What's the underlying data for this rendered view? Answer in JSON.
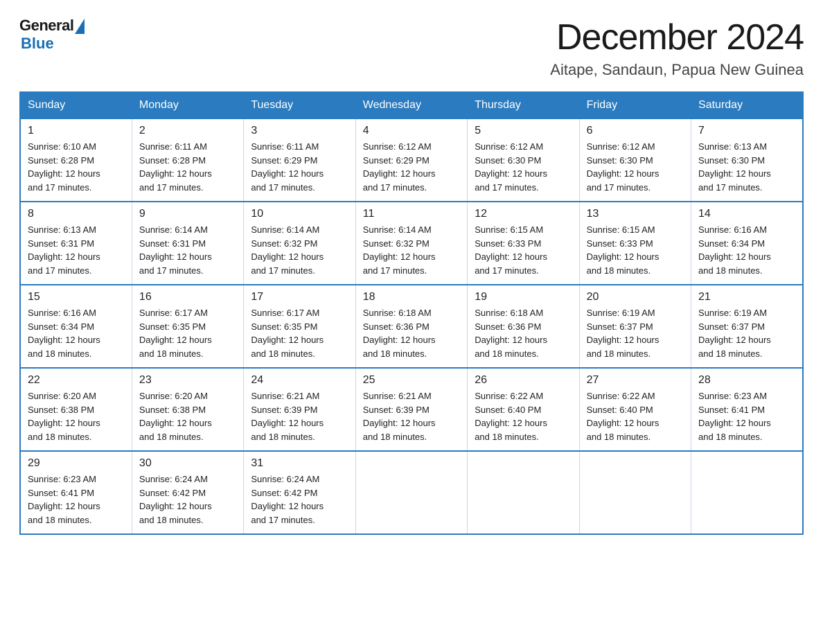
{
  "header": {
    "logo_general": "General",
    "logo_blue": "Blue",
    "month_title": "December 2024",
    "location": "Aitape, Sandaun, Papua New Guinea"
  },
  "weekdays": [
    "Sunday",
    "Monday",
    "Tuesday",
    "Wednesday",
    "Thursday",
    "Friday",
    "Saturday"
  ],
  "weeks": [
    [
      {
        "day": "1",
        "sunrise": "6:10 AM",
        "sunset": "6:28 PM",
        "daylight": "12 hours and 17 minutes."
      },
      {
        "day": "2",
        "sunrise": "6:11 AM",
        "sunset": "6:28 PM",
        "daylight": "12 hours and 17 minutes."
      },
      {
        "day": "3",
        "sunrise": "6:11 AM",
        "sunset": "6:29 PM",
        "daylight": "12 hours and 17 minutes."
      },
      {
        "day": "4",
        "sunrise": "6:12 AM",
        "sunset": "6:29 PM",
        "daylight": "12 hours and 17 minutes."
      },
      {
        "day": "5",
        "sunrise": "6:12 AM",
        "sunset": "6:30 PM",
        "daylight": "12 hours and 17 minutes."
      },
      {
        "day": "6",
        "sunrise": "6:12 AM",
        "sunset": "6:30 PM",
        "daylight": "12 hours and 17 minutes."
      },
      {
        "day": "7",
        "sunrise": "6:13 AM",
        "sunset": "6:30 PM",
        "daylight": "12 hours and 17 minutes."
      }
    ],
    [
      {
        "day": "8",
        "sunrise": "6:13 AM",
        "sunset": "6:31 PM",
        "daylight": "12 hours and 17 minutes."
      },
      {
        "day": "9",
        "sunrise": "6:14 AM",
        "sunset": "6:31 PM",
        "daylight": "12 hours and 17 minutes."
      },
      {
        "day": "10",
        "sunrise": "6:14 AM",
        "sunset": "6:32 PM",
        "daylight": "12 hours and 17 minutes."
      },
      {
        "day": "11",
        "sunrise": "6:14 AM",
        "sunset": "6:32 PM",
        "daylight": "12 hours and 17 minutes."
      },
      {
        "day": "12",
        "sunrise": "6:15 AM",
        "sunset": "6:33 PM",
        "daylight": "12 hours and 17 minutes."
      },
      {
        "day": "13",
        "sunrise": "6:15 AM",
        "sunset": "6:33 PM",
        "daylight": "12 hours and 18 minutes."
      },
      {
        "day": "14",
        "sunrise": "6:16 AM",
        "sunset": "6:34 PM",
        "daylight": "12 hours and 18 minutes."
      }
    ],
    [
      {
        "day": "15",
        "sunrise": "6:16 AM",
        "sunset": "6:34 PM",
        "daylight": "12 hours and 18 minutes."
      },
      {
        "day": "16",
        "sunrise": "6:17 AM",
        "sunset": "6:35 PM",
        "daylight": "12 hours and 18 minutes."
      },
      {
        "day": "17",
        "sunrise": "6:17 AM",
        "sunset": "6:35 PM",
        "daylight": "12 hours and 18 minutes."
      },
      {
        "day": "18",
        "sunrise": "6:18 AM",
        "sunset": "6:36 PM",
        "daylight": "12 hours and 18 minutes."
      },
      {
        "day": "19",
        "sunrise": "6:18 AM",
        "sunset": "6:36 PM",
        "daylight": "12 hours and 18 minutes."
      },
      {
        "day": "20",
        "sunrise": "6:19 AM",
        "sunset": "6:37 PM",
        "daylight": "12 hours and 18 minutes."
      },
      {
        "day": "21",
        "sunrise": "6:19 AM",
        "sunset": "6:37 PM",
        "daylight": "12 hours and 18 minutes."
      }
    ],
    [
      {
        "day": "22",
        "sunrise": "6:20 AM",
        "sunset": "6:38 PM",
        "daylight": "12 hours and 18 minutes."
      },
      {
        "day": "23",
        "sunrise": "6:20 AM",
        "sunset": "6:38 PM",
        "daylight": "12 hours and 18 minutes."
      },
      {
        "day": "24",
        "sunrise": "6:21 AM",
        "sunset": "6:39 PM",
        "daylight": "12 hours and 18 minutes."
      },
      {
        "day": "25",
        "sunrise": "6:21 AM",
        "sunset": "6:39 PM",
        "daylight": "12 hours and 18 minutes."
      },
      {
        "day": "26",
        "sunrise": "6:22 AM",
        "sunset": "6:40 PM",
        "daylight": "12 hours and 18 minutes."
      },
      {
        "day": "27",
        "sunrise": "6:22 AM",
        "sunset": "6:40 PM",
        "daylight": "12 hours and 18 minutes."
      },
      {
        "day": "28",
        "sunrise": "6:23 AM",
        "sunset": "6:41 PM",
        "daylight": "12 hours and 18 minutes."
      }
    ],
    [
      {
        "day": "29",
        "sunrise": "6:23 AM",
        "sunset": "6:41 PM",
        "daylight": "12 hours and 18 minutes."
      },
      {
        "day": "30",
        "sunrise": "6:24 AM",
        "sunset": "6:42 PM",
        "daylight": "12 hours and 18 minutes."
      },
      {
        "day": "31",
        "sunrise": "6:24 AM",
        "sunset": "6:42 PM",
        "daylight": "12 hours and 17 minutes."
      },
      null,
      null,
      null,
      null
    ]
  ],
  "labels": {
    "sunrise_prefix": "Sunrise: ",
    "sunset_prefix": "Sunset: ",
    "daylight_prefix": "Daylight: "
  }
}
